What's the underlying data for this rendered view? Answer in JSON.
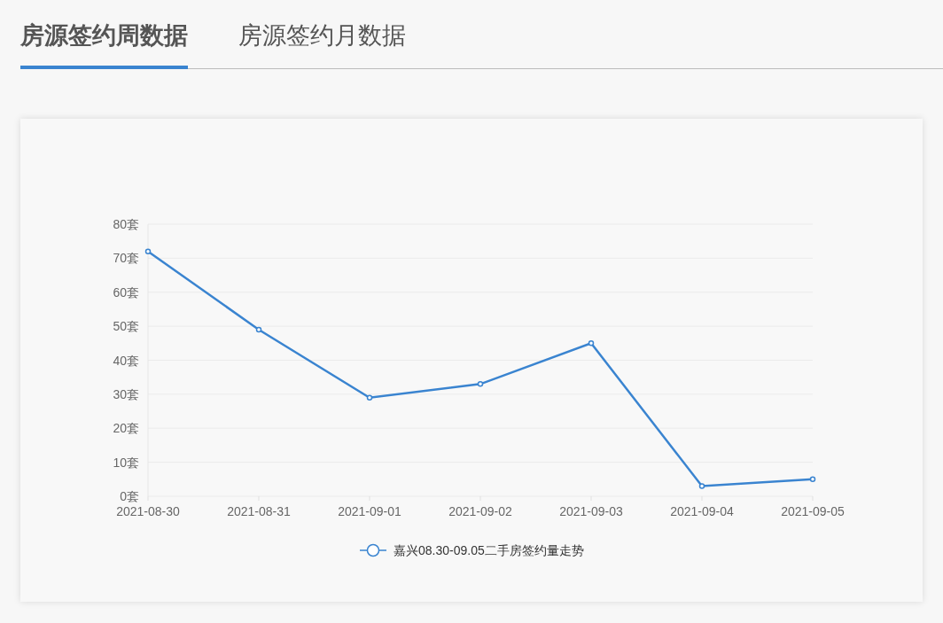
{
  "tabs": [
    {
      "label": "房源签约周数据",
      "selected": true
    },
    {
      "label": "房源签约月数据",
      "selected": false
    }
  ],
  "chart": {
    "chart_data": {
      "type": "line",
      "categories": [
        "2021-08-30",
        "2021-08-31",
        "2021-09-01",
        "2021-09-02",
        "2021-09-03",
        "2021-09-04",
        "2021-09-05"
      ],
      "series": [
        {
          "name": "嘉兴08.30-09.05二手房签约量走势",
          "color": "#3a84d0",
          "marker": true,
          "values": [
            72,
            49,
            29,
            33,
            45,
            3,
            5
          ]
        }
      ],
      "grid": true,
      "ylim": [
        0,
        80
      ],
      "yticks": [
        {
          "value": 0,
          "label": "0套"
        },
        {
          "value": 10,
          "label": "10套"
        },
        {
          "value": 20,
          "label": "20套"
        },
        {
          "value": 30,
          "label": "30套"
        },
        {
          "value": 40,
          "label": "40套"
        },
        {
          "value": 50,
          "label": "50套"
        },
        {
          "value": 60,
          "label": "60套"
        },
        {
          "value": 70,
          "label": "70套"
        },
        {
          "value": 80,
          "label": "80套"
        }
      ]
    }
  }
}
